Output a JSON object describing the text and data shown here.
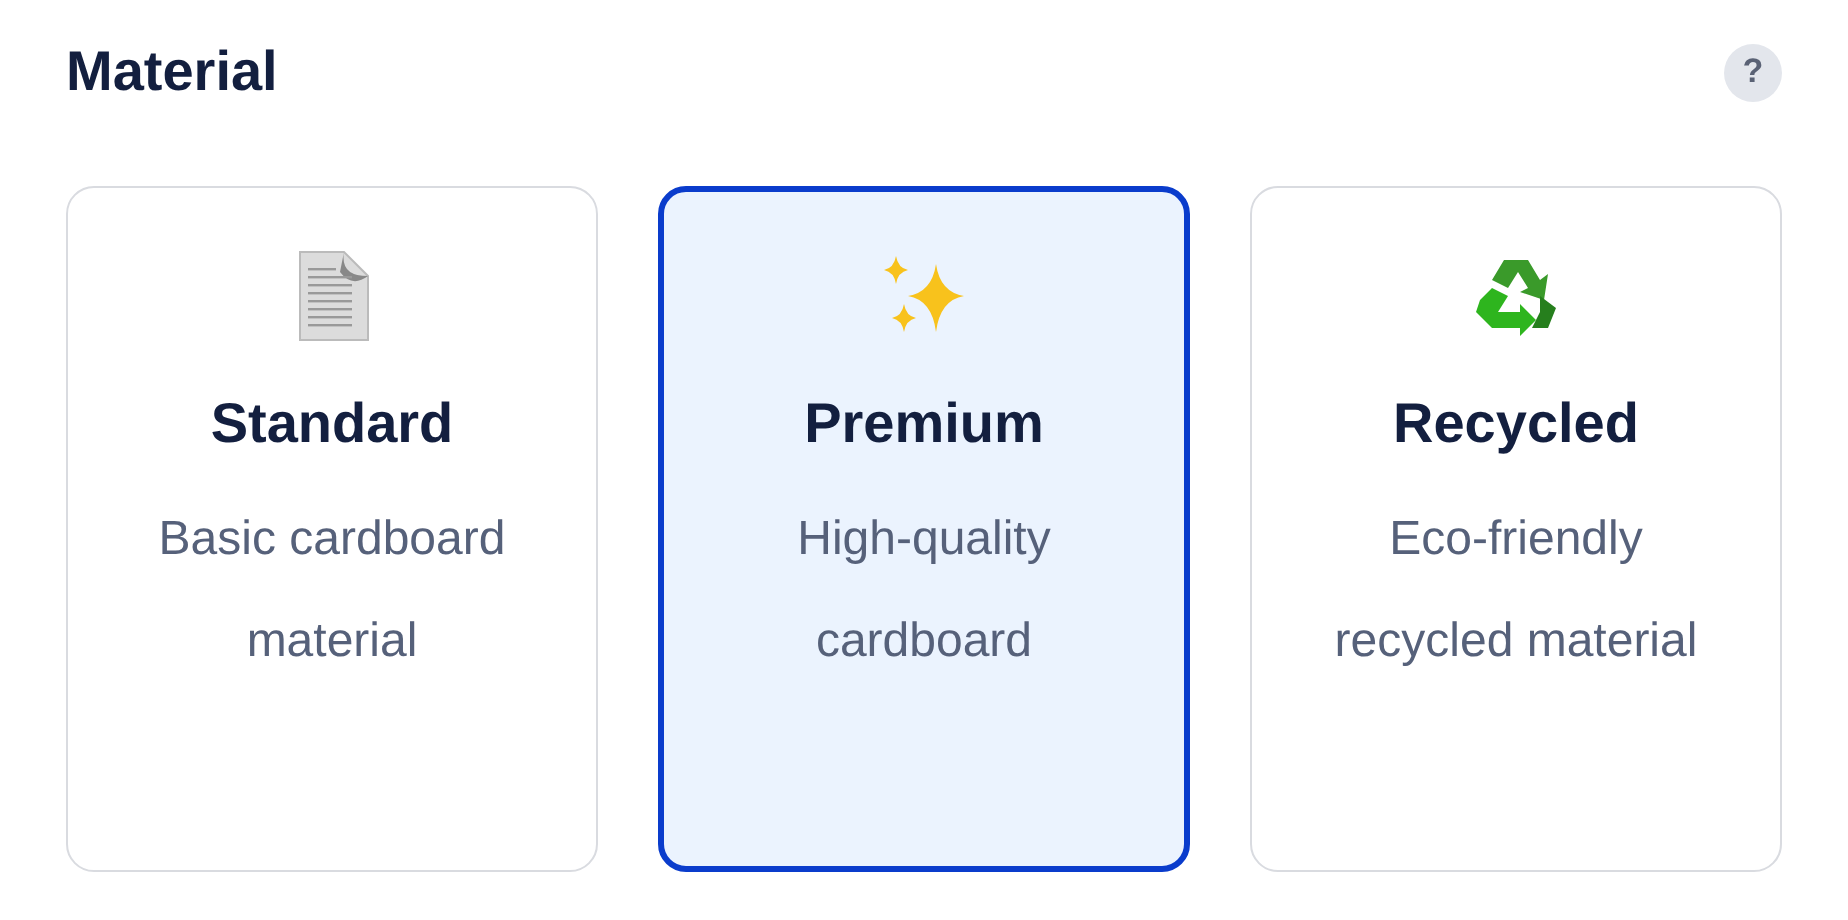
{
  "section": {
    "title": "Material",
    "help": "?"
  },
  "options": [
    {
      "title": "Standard",
      "description": "Basic cardboard material",
      "selected": false
    },
    {
      "title": "Premium",
      "description": "High-quality cardboard",
      "selected": true
    },
    {
      "title": "Recycled",
      "description": "Eco-friendly recycled material",
      "selected": false
    }
  ]
}
